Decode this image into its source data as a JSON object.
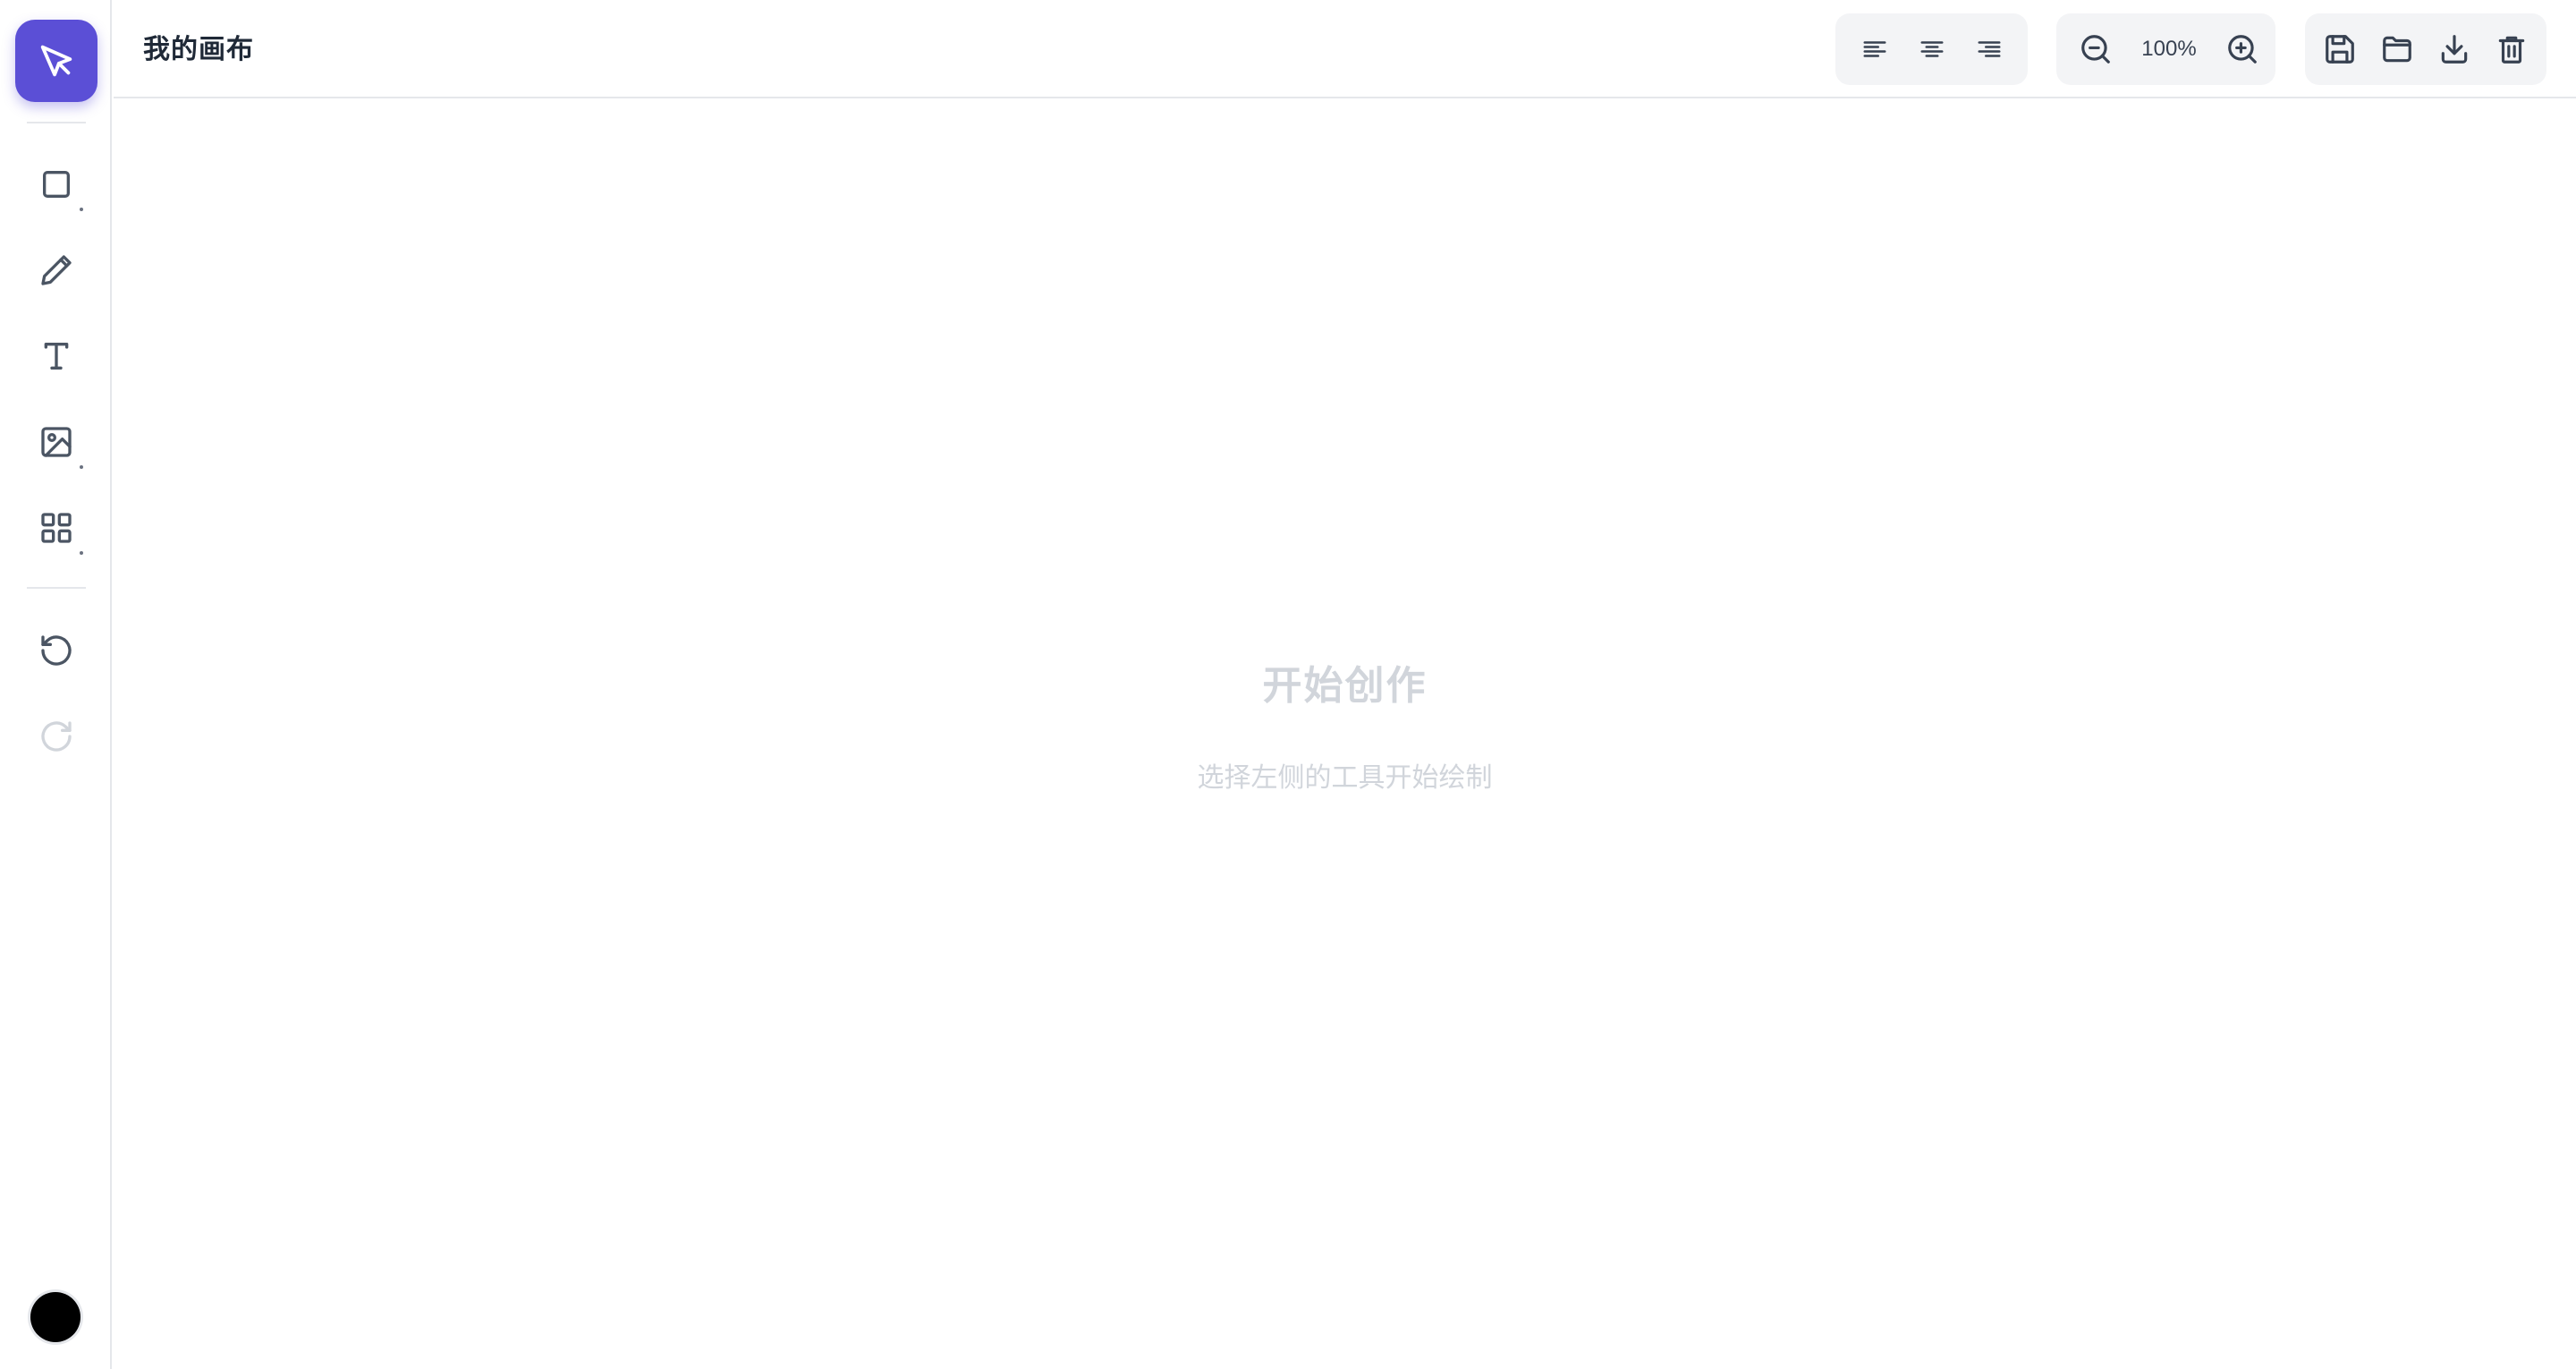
{
  "app": {
    "title": "我的画布"
  },
  "sidebar": {
    "tools": [
      {
        "name": "select",
        "icon": "pointer-icon",
        "active": true
      },
      {
        "name": "shape",
        "icon": "square-icon",
        "has_submenu": true
      },
      {
        "name": "pen",
        "icon": "pencil-icon"
      },
      {
        "name": "text",
        "icon": "text-icon"
      },
      {
        "name": "image",
        "icon": "image-icon",
        "has_submenu": true
      },
      {
        "name": "components",
        "icon": "grid-icon",
        "has_submenu": true
      }
    ],
    "history": [
      {
        "name": "undo",
        "icon": "undo-icon",
        "enabled": true
      },
      {
        "name": "redo",
        "icon": "redo-icon",
        "enabled": false
      }
    ],
    "current_color": "#000000"
  },
  "toolbar": {
    "align_buttons": [
      {
        "name": "align-left",
        "icon": "align-left-icon"
      },
      {
        "name": "align-center",
        "icon": "align-center-icon"
      },
      {
        "name": "align-right",
        "icon": "align-right-icon"
      }
    ],
    "zoom": {
      "value": "100%",
      "zoom_out_icon": "zoom-out-icon",
      "zoom_in_icon": "zoom-in-icon"
    },
    "file_buttons": [
      {
        "name": "save",
        "icon": "save-icon"
      },
      {
        "name": "open",
        "icon": "folder-icon"
      },
      {
        "name": "export",
        "icon": "download-icon"
      },
      {
        "name": "clear",
        "icon": "trash-icon"
      }
    ]
  },
  "canvas": {
    "empty_title": "开始创作",
    "empty_subtitle": "选择左侧的工具开始绘制"
  },
  "colors": {
    "accent": "#5b4fd6",
    "border": "#e5e7eb",
    "placeholder_text": "#d1d5db",
    "toolbar_bg": "#f3f4f6"
  }
}
